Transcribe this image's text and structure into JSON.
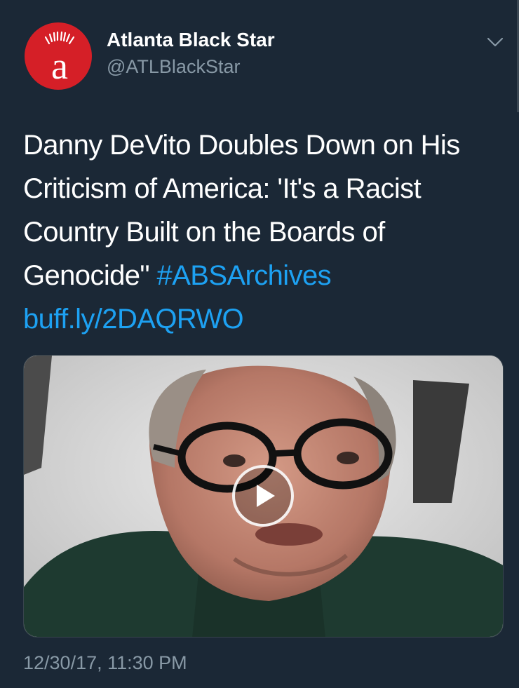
{
  "account": {
    "display_name": "Atlanta Black Star",
    "handle": "@ATLBlackStar",
    "avatar_letter": "a",
    "avatar_icon": "atlanta-black-star-logo-icon"
  },
  "tweet": {
    "text": "Danny DeVito Doubles Down on His Criticism of America: 'It's a Racist Country Built on the Boards of Genocide\"",
    "hashtag": "#ABSArchives",
    "link": "buff.ly/2DAQRWO",
    "timestamp": "12/30/17, 11:30 PM"
  },
  "media": {
    "type": "video",
    "play_icon": "play-icon"
  },
  "menu": {
    "caret_icon": "chevron-down-icon"
  },
  "colors": {
    "background": "#1b2836",
    "text": "#ffffff",
    "secondary_text": "#8899a6",
    "link": "#1da1f2",
    "avatar_red": "#d51f27"
  }
}
